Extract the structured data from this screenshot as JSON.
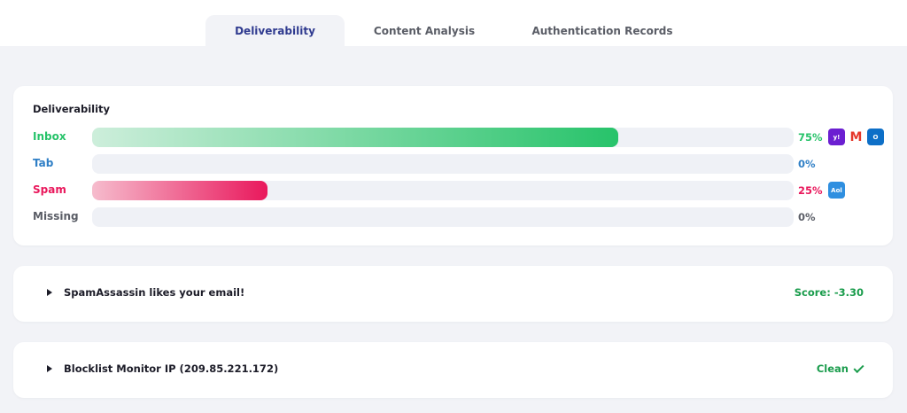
{
  "tabs": [
    {
      "label": "Deliverability",
      "active": true
    },
    {
      "label": "Content Analysis",
      "active": false
    },
    {
      "label": "Authentication Records",
      "active": false
    }
  ],
  "deliverability": {
    "title": "Deliverability",
    "rows": [
      {
        "label": "Inbox",
        "percent": "75%",
        "value": 75,
        "color": "#27c36a",
        "providers": [
          "yahoo-icon",
          "gmail-icon",
          "outlook-icon"
        ]
      },
      {
        "label": "Tab",
        "percent": "0%",
        "value": 0,
        "color": "#2f7fc6",
        "providers": []
      },
      {
        "label": "Spam",
        "percent": "25%",
        "value": 25,
        "color": "#e9185c",
        "providers": [
          "aol-icon"
        ]
      },
      {
        "label": "Missing",
        "percent": "0%",
        "value": 0,
        "color": "#5a5d66",
        "providers": []
      }
    ],
    "provider_badges": {
      "yahoo": "y!",
      "gmail": "M",
      "outlook": "O",
      "aol": "Aol"
    }
  },
  "spamassassin": {
    "title": "SpamAssassin likes your email!",
    "score": "Score: -3.30"
  },
  "blocklist": {
    "title": "Blocklist Monitor IP (209.85.221.172)",
    "status": "Clean"
  },
  "colors": {
    "accent": "#2f3a8f",
    "success": "#1a9c4c",
    "inbox": "#27c36a",
    "spam": "#e9185c",
    "tab": "#2f7fc6"
  }
}
